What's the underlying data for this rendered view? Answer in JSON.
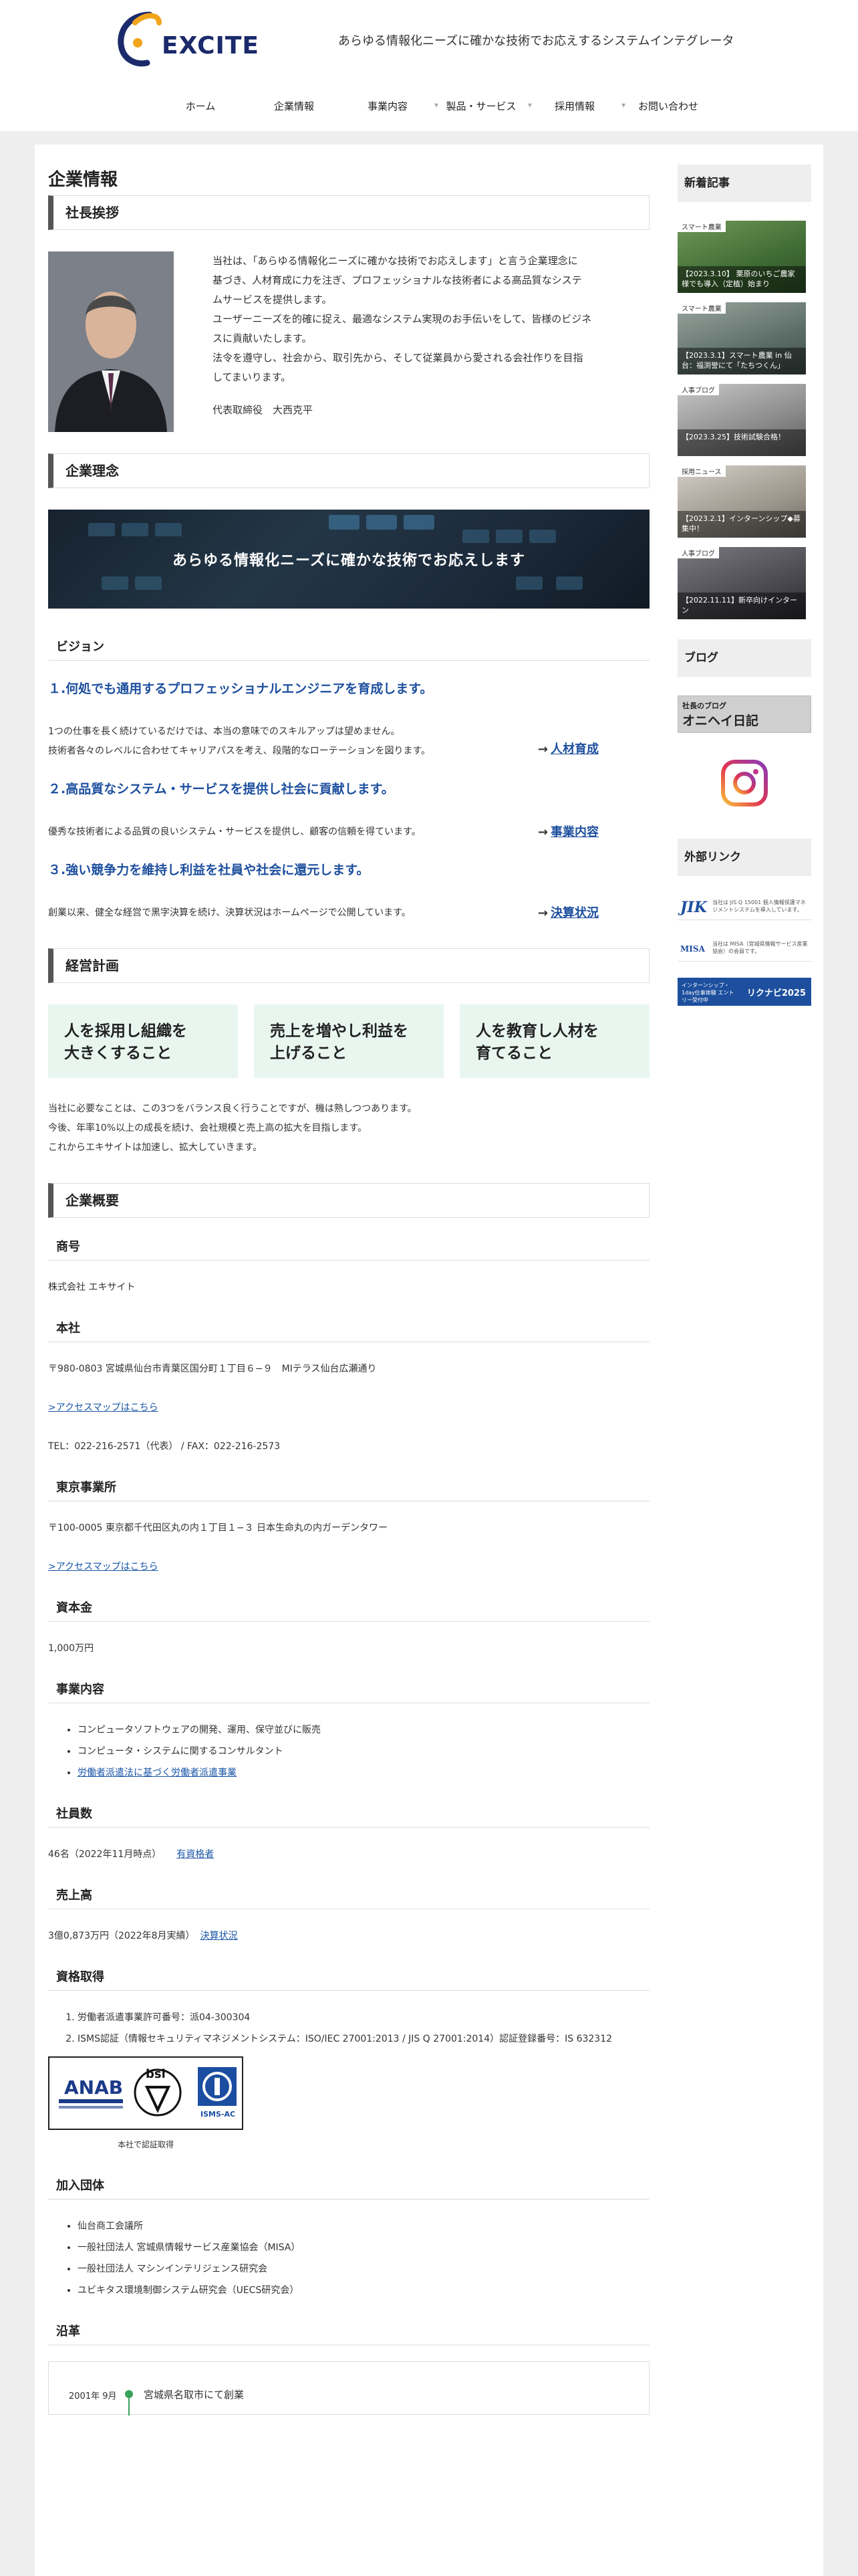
{
  "header": {
    "logo_text": "EXCITE",
    "tagline": "あらゆる情報化ニーズに確かな技術でお応えするシステムインテグレータ",
    "nav": [
      {
        "label": "ホーム"
      },
      {
        "label": "企業情報"
      },
      {
        "label": "事業内容"
      },
      {
        "label": "製品・サービス"
      },
      {
        "label": "採用情報"
      },
      {
        "label": "お問い合わせ"
      }
    ]
  },
  "page_title": "企業情報",
  "greeting": {
    "heading": "社長挨拶",
    "lines": [
      "当社は、「あらゆる情報化ニーズに確かな技術でお応えします」と言う企業理念に",
      "基づき、人材育成に力を注ぎ、プロフェッショナルな技術者による高品質なシステ",
      "ムサービスを提供します。",
      "ユーザーニーズを的確に捉え、最適なシステム実現のお手伝いをして、皆様のビジネ",
      "スに貢献いたします。",
      "法令を遵守し、社会から、取引先から、そして従業員から愛される会社作りを目指",
      "してまいります。"
    ],
    "signature": "代表取締役　大西克平"
  },
  "philosophy": {
    "heading": "企業理念",
    "banner": "あらゆる情報化ニーズに確かな技術でお応えします",
    "vision_heading": "ビジョン",
    "visions": [
      {
        "title": "１.何処でも通用するプロフェッショナルエンジニアを育成します。",
        "body": [
          "1つの仕事を長く続けているだけでは、本当の意味でのスキルアップは望めません。",
          "技術者各々のレベルに合わせてキャリアパスを考え、段階的なローテーションを図ります。"
        ],
        "arrow": "→",
        "link": "人材育成"
      },
      {
        "title": "２.高品質なシステム・サービスを提供し社会に貢献します。",
        "body": [
          "優秀な技術者による品質の良いシステム・サービスを提供し、顧客の信頼を得ています。"
        ],
        "arrow": "→",
        "link": "事業内容"
      },
      {
        "title": "３.強い競争力を維持し利益を社員や社会に還元します。",
        "body": [
          "創業以来、健全な経営で黒字決算を続け、決算状況はホームページで公開しています。"
        ],
        "arrow": "→",
        "link": "決算状況"
      }
    ]
  },
  "plan": {
    "heading": "経営計画",
    "boxes": [
      {
        "line1": "人を採用し組織を",
        "line2": "大きくすること"
      },
      {
        "line1": "売上を増やし利益を",
        "line2": "上げること"
      },
      {
        "line1": "人を教育し人材を",
        "line2": "育てること"
      }
    ],
    "text": [
      "当社に必要なことは、この3つをバランス良く行うことですが、機は熟しつつあります。",
      "今後、年率10%以上の成長を続け、会社規模と売上高の拡大を目指します。",
      "これからエキサイトは加速し、拡大していきます。"
    ]
  },
  "overview": {
    "heading": "企業概要",
    "trade_name": {
      "label": "商号",
      "value": "株式会社 エキサイト"
    },
    "head_office": {
      "label": "本社",
      "address": "〒980-0803 宮城県仙台市青葉区国分町１丁目６−９　MIテラス仙台広瀬通り",
      "map_link": ">アクセスマップはこちら",
      "tel": "TEL：022-216-2571（代表） / FAX：022-216-2573"
    },
    "tokyo_office": {
      "label": "東京事業所",
      "address": "〒100-0005 東京都千代田区丸の内１丁目１−３ 日本生命丸の内ガーデンタワー",
      "map_link": ">アクセスマップはこちら"
    },
    "capital": {
      "label": "資本金",
      "value": "1,000万円"
    },
    "business": {
      "label": "事業内容",
      "items": [
        "コンピュータソフトウェアの開発、運用、保守並びに販売",
        "コンピュータ・システムに関するコンサルタント"
      ],
      "link_item": "労働者派遣法に基づく労働者派遣事業"
    },
    "employees": {
      "label": "社員数",
      "value": "46名（2022年11月時点）",
      "link": "有資格者"
    },
    "sales": {
      "label": "売上高",
      "value": "3億0,873万円（2022年8月実績）",
      "link": "決算状況"
    },
    "qualifications": {
      "label": "資格取得",
      "items": [
        "労働者派遣事業許可番号：派04-300304",
        "ISMS認証（情報セキュリティマネジメントシステム：ISO/IEC 27001:2013 / JIS Q 27001:2014）認証登録番号：IS 632312"
      ],
      "cert_caption": "本社で認証取得",
      "cert_anab": "ANAB",
      "cert_bsi": "bsi",
      "cert_isms": "ISMS-AC"
    },
    "memberships": {
      "label": "加入団体",
      "items": [
        "仙台商工会議所",
        "一般社団法人 宮城県情報サービス産業協会（MISA）",
        "一般社団法人 マシンインテリジェンス研究会",
        "ユビキタス環境制御システム研究会（UECS研究会）"
      ]
    },
    "history": {
      "label": "沿革",
      "year": "2001年 9月",
      "event": "宮城県名取市にて創業"
    }
  },
  "sidebar": {
    "news_heading": "新着記事",
    "news": [
      {
        "tag": "スマート農業",
        "caption": "【2023.3.10】 栗原のいちご農家様でも導入（定植）始まり"
      },
      {
        "tag": "スマート農業",
        "caption": "【2023.3.1】スマート農業 in 仙台：福渕誉にて「たちつくん」"
      },
      {
        "tag": "人事ブログ",
        "caption": "【2023.3.25】技術試験合格！"
      },
      {
        "tag": "採用ニュース",
        "caption": "【2023.2.1】インターンシップ◆募集中！"
      },
      {
        "tag": "人事ブログ",
        "caption": "【2022.11.11】新卒向けインターン"
      }
    ],
    "blog_heading": "ブログ",
    "blog_small": "社長のブログ",
    "blog_big": "オニヘイ日記",
    "instagram": "instagram-icon",
    "external_heading": "外部リンク",
    "ext1_logo": "JIK",
    "ext1_text": "当社は JIS Q 15001 個人情報保護マネジメントシステムを導入しています。",
    "ext2_logo": "MISA",
    "ext2_text": "当社は MISA（宮城県情報サービス産業協会）の会員です。",
    "rikunabi_left": "インターンシップ・1day仕事体験 エントリー受付中",
    "rikunabi_right": "リクナビ2025"
  }
}
